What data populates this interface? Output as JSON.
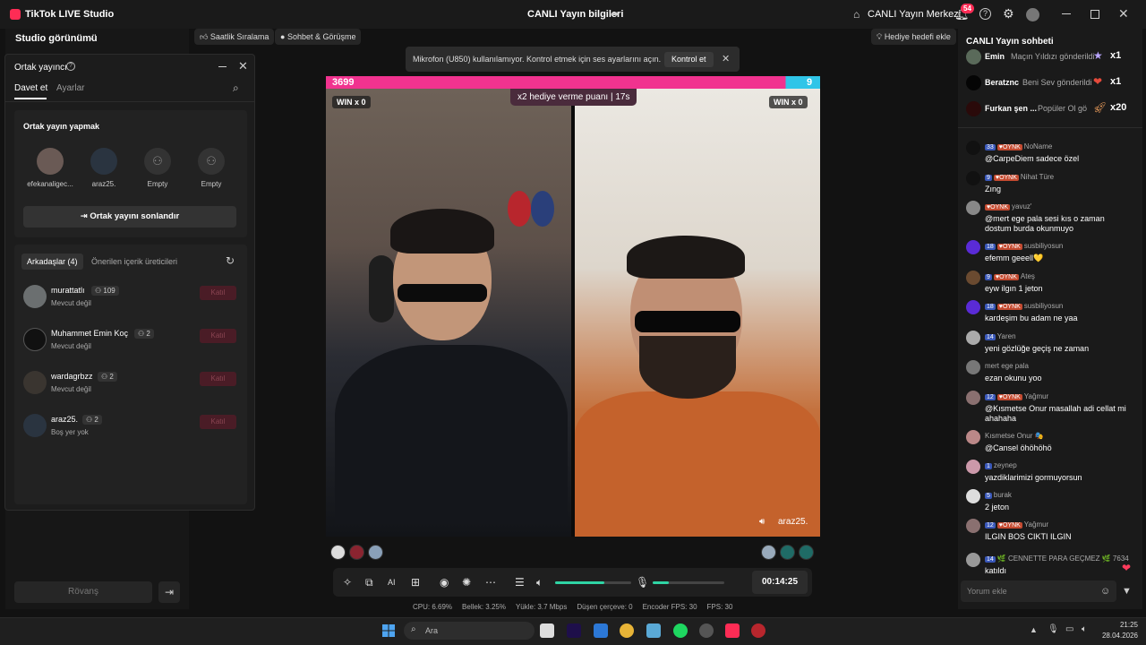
{
  "window": {
    "title": "TikTok LIVE Studio",
    "center_title": "CANLI Yayın bilgileri",
    "live_center": "CANLI Yayın Merkezi",
    "notifications": "54"
  },
  "left": {
    "studio_view": "Studio görünümü",
    "rematch": "Rövanş"
  },
  "cohost": {
    "title": "Ortak yayıncı",
    "tab_invite": "Davet et",
    "tab_settings": "Ayarlar",
    "section_title": "Ortak yayın yapmak",
    "slots": [
      {
        "name": "efekanaligec..."
      },
      {
        "name": "araz25."
      },
      {
        "name": "Empty"
      },
      {
        "name": "Empty"
      }
    ],
    "end_button": "Ortak yayını sonlandır",
    "tab_friends": "Arkadaşlar (4)",
    "tab_suggested": "Önerilen içerik üreticileri",
    "friends": [
      {
        "name": "murattatlı",
        "count": "109",
        "status": "Mevcut değil",
        "join": "Katıl"
      },
      {
        "name": "Muhammet Emin Koç",
        "count": "2",
        "status": "Mevcut değil",
        "join": "Katıl"
      },
      {
        "name": "wardagrbzz",
        "count": "2",
        "status": "Mevcut değil",
        "join": "Katıl"
      },
      {
        "name": "araz25.",
        "count": "2",
        "status": "Boş yer yok",
        "join": "Katıl"
      }
    ]
  },
  "chips": {
    "hourly": "Saatlik Sıralama",
    "chat": "Sohbet & Görüşme",
    "gift_goal": "Hediye hedefi ekle"
  },
  "toast": {
    "text": "Mikrofon (U850) kullanılamıyor. Kontrol etmek için ses ayarlarını açın.",
    "button": "Kontrol et"
  },
  "battle": {
    "score_left": "3699",
    "score_right": "9",
    "multiplier": "x2 hediye verme puanı",
    "multiplier_time": "17s",
    "win_left": "WIN x 0",
    "win_right": "WIN x 0",
    "right_name": "araz25.",
    "score_fraction": 0.93
  },
  "controls": {
    "timer": "00:14:25",
    "volume_level": 0.65,
    "mic_level": 0.22
  },
  "stats": {
    "cpu": "CPU: 6.69%",
    "mem": "Bellek: 3.25%",
    "upload": "Yükle: 3.7 Mbps",
    "dropped": "Düşen çerçeve: 0",
    "encoder": "Encoder FPS: 30",
    "fps": "FPS: 30"
  },
  "chat": {
    "title": "CANLI Yayın sohbeti",
    "gifts": [
      {
        "name": "Emin",
        "text": "Maçın Yıldızı gönderildi",
        "count": "x1",
        "icon": "star-gift-icon"
      },
      {
        "name": "Beratznc",
        "text": "Beni Sev gönderildi",
        "count": "x1",
        "icon": "heart-gift-icon"
      },
      {
        "name": "Furkan şen ...",
        "text": "Popüler Ol gö",
        "count": "x20",
        "icon": "rocket-gift-icon"
      }
    ],
    "messages": [
      {
        "level": "33",
        "oynk": true,
        "user": "NoName",
        "text": "@CarpeDiem sadece özel"
      },
      {
        "level": "9",
        "oynk": true,
        "user": "Nihat Türe",
        "text": "Zıng"
      },
      {
        "level": "",
        "oynk": true,
        "user": "yavuz'",
        "text": "@mert ege pala sesi kıs o zaman dostum burda okunmuyo"
      },
      {
        "level": "18",
        "oynk": true,
        "user": "susbiliyosun",
        "text": "efemm geeell💛"
      },
      {
        "level": "9",
        "oynk": true,
        "user": "Ateş",
        "text": "eyw ilgın 1 jeton"
      },
      {
        "level": "18",
        "oynk": true,
        "user": "susbiliyosun",
        "text": "kardeşim bu adam ne yaa"
      },
      {
        "level": "14",
        "oynk": false,
        "user": "Yaren",
        "text": "yeni gözlüğe geçiş ne zaman"
      },
      {
        "level": "",
        "oynk": false,
        "user": "mert ege pala",
        "text": "ezan okunu yoo"
      },
      {
        "level": "12",
        "oynk": true,
        "user": "Yağmur",
        "text": "@Kısmetse Onur masallah adi cellat mi ahahaha"
      },
      {
        "level": "",
        "oynk": false,
        "user": "Kısmetse Onur 🎭",
        "text": "@Cansel öhöhöhö"
      },
      {
        "level": "1",
        "oynk": false,
        "user": "zeynep",
        "text": "yazdiklarimizi gormuyorsun"
      },
      {
        "level": "5",
        "oynk": false,
        "user": "burak",
        "text": "2 jeton"
      },
      {
        "level": "12",
        "oynk": true,
        "user": "Yağmur",
        "text": "ILGIN BOS CIKTI ILGIN"
      },
      {
        "level": "14",
        "oynk": false,
        "user": "🌿 CENNETTE PARA GEÇMEZ 🌿 7634",
        "text": "katıldı"
      }
    ],
    "comment_placeholder": "Yorum ekle"
  },
  "taskbar": {
    "search": "Ara",
    "time": "21:25",
    "date": "28.04.2026"
  },
  "colors": {
    "accent": "#fe2c55",
    "battle_pink": "#f1338f",
    "battle_blue": "#2fc5e8",
    "level_green": "#2fd4a4"
  }
}
